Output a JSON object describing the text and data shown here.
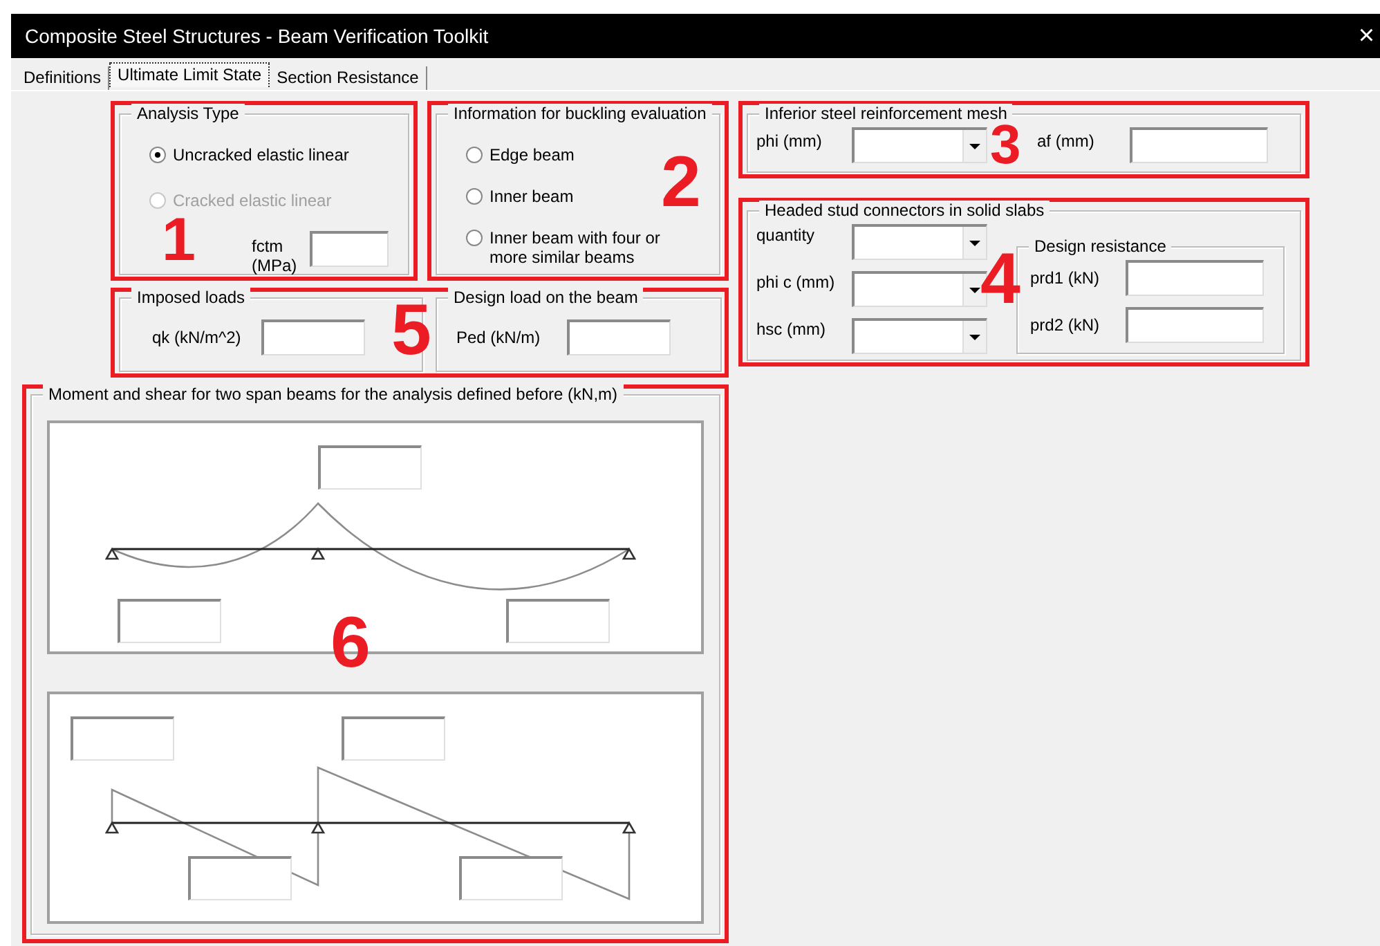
{
  "window": {
    "title": "Composite Steel Structures - Beam Verification Toolkit",
    "close": "×"
  },
  "tabs": [
    {
      "label": "Definitions",
      "selected": false
    },
    {
      "label": "Ultimate Limit State",
      "selected": true
    },
    {
      "label": "Section Resistance",
      "selected": false
    }
  ],
  "analysis_type": {
    "callout": "1",
    "title": "Analysis Type",
    "options": [
      {
        "label": "Uncracked elastic linear",
        "selected": true,
        "disabled": false
      },
      {
        "label": "Cracked elastic linear",
        "selected": false,
        "disabled": true
      }
    ],
    "field_label": "fctm (MPa)"
  },
  "buckling": {
    "callout": "2",
    "title": "Information for buckling evaluation",
    "options": [
      {
        "label": "Edge beam",
        "selected": false,
        "disabled": false
      },
      {
        "label": "Inner beam",
        "selected": false,
        "disabled": false
      },
      {
        "label": "Inner beam with four or more similar beams",
        "selected": false,
        "disabled": false
      }
    ]
  },
  "mesh": {
    "callout": "3",
    "title": "Inferior steel reinforcement mesh",
    "fields": [
      {
        "kind": "combo",
        "label": "phi (mm)"
      },
      {
        "kind": "text",
        "label": "af (mm)"
      }
    ]
  },
  "studs": {
    "callout": "4",
    "title": "Headed stud connectors in solid slabs",
    "fields": [
      {
        "kind": "combo",
        "label": "quantity"
      },
      {
        "kind": "combo",
        "label": "phi c (mm)"
      },
      {
        "kind": "combo",
        "label": "hsc (mm)"
      }
    ],
    "design_resistance": {
      "title": "Design resistance",
      "fields": [
        {
          "kind": "text",
          "label": "prd1 (kN)"
        },
        {
          "kind": "text",
          "label": "prd2 (kN)"
        }
      ]
    }
  },
  "loads": {
    "callout": "5",
    "imposed": {
      "title": "Imposed loads",
      "label": "qk (kN/m^2)"
    },
    "design": {
      "title": "Design load on the beam",
      "label": "Ped (kN/m)"
    }
  },
  "diagrams": {
    "callout": "6",
    "title": "Moment and shear for two span beams for the analysis defined before (kN,m)",
    "panels": [
      {
        "kind": "moment"
      },
      {
        "kind": "shear"
      }
    ]
  }
}
